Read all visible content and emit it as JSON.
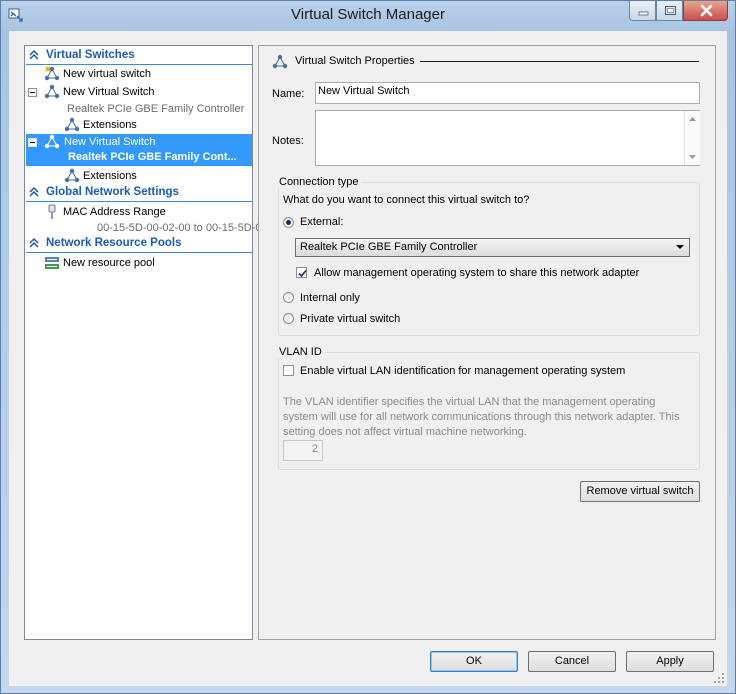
{
  "window": {
    "title": "Virtual Switch Manager"
  },
  "tree": {
    "sections": {
      "virtual_switches": "Virtual Switches",
      "global_network_settings": "Global Network Settings",
      "network_resource_pools": "Network Resource Pools"
    },
    "new_virtual_switch": "New virtual switch",
    "switch1": {
      "name": "New Virtual Switch",
      "adapter": "Realtek PCIe GBE Family Controller",
      "extensions": "Extensions"
    },
    "switch2": {
      "name": "New Virtual Switch",
      "adapter": "Realtek PCIe GBE Family Cont...",
      "extensions": "Extensions"
    },
    "mac_address_range": {
      "label": "MAC Address Range",
      "value": "00-15-5D-00-02-00 to 00-15-5D-0..."
    },
    "new_resource_pool": "New resource pool"
  },
  "panel": {
    "header": "Virtual Switch Properties",
    "name_label": "Name:",
    "name_value": "New Virtual Switch",
    "notes_label": "Notes:",
    "notes_value": "",
    "connection_type": {
      "title": "Connection type",
      "question": "What do you want to connect this virtual switch to?",
      "external_label": "External:",
      "external_adapter": "Realtek PCIe GBE Family Controller",
      "allow_management": "Allow management operating system to share this network adapter",
      "internal_only": "Internal only",
      "private": "Private virtual switch",
      "selected": "External"
    },
    "vlan": {
      "title": "VLAN ID",
      "enable_label": "Enable virtual LAN identification for management operating system",
      "description": "The VLAN identifier specifies the virtual LAN that the management operating system will use for all network communications through this network adapter. This setting does not affect virtual machine networking.",
      "value": "2"
    },
    "remove_button": "Remove virtual switch"
  },
  "footer": {
    "ok": "OK",
    "cancel": "Cancel",
    "apply": "Apply"
  },
  "colors": {
    "selection": "#3399ff",
    "section_header": "#1b5bb6",
    "window_frame": "#b9d1ea"
  }
}
